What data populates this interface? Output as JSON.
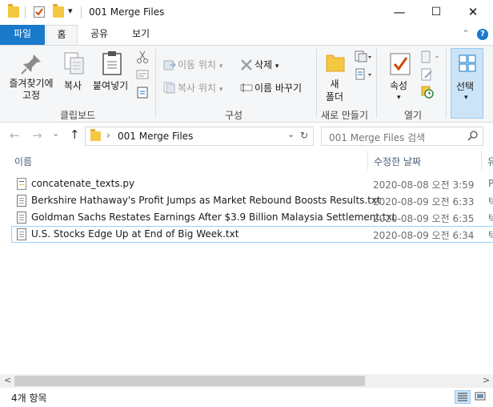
{
  "window": {
    "title": "001 Merge Files",
    "minimize": "—",
    "maximize": "☐",
    "close": "✕"
  },
  "qat": {
    "dropdown": "▾"
  },
  "ribbon_tabs": {
    "file": "파일",
    "home": "홈",
    "share": "공유",
    "view": "보기",
    "collapse": "⌃",
    "help": "?"
  },
  "clipboard": {
    "pin": "즐겨찾기에\n고정",
    "copy": "복사",
    "paste": "붙여넣기",
    "group": "클립보드"
  },
  "organize": {
    "move_to": "이동 위치",
    "copy_to": "복사 위치",
    "delete": "삭제",
    "rename": "이름 바꾸기",
    "group": "구성"
  },
  "new": {
    "new_folder": "새\n폴더",
    "group": "새로 만들기"
  },
  "open": {
    "properties": "속성",
    "group": "열기"
  },
  "select": {
    "select": "선택"
  },
  "address": {
    "back": "←",
    "forward": "→",
    "recent": "⌄",
    "up": "↑",
    "separator": "›",
    "path": "001 Merge Files",
    "dropdown": "⌄",
    "refresh": "↻",
    "search_placeholder": "001 Merge Files 검색",
    "search_icon": "⚲"
  },
  "columns": {
    "name": "이름",
    "modified": "수정한 날짜",
    "type": "유"
  },
  "files": [
    {
      "name": "concatenate_texts.py",
      "date": "2020-08-08 오전 3:59",
      "extra": "P",
      "icon": "python-file-icon"
    },
    {
      "name": "Berkshire Hathaway's Profit Jumps as Market Rebound Boosts Results.txt",
      "date": "2020-08-09 오전 6:33",
      "extra": "텍",
      "icon": "text-file-icon"
    },
    {
      "name": "Goldman Sachs Restates Earnings After $3.9 Billion Malaysia Settlement.txt",
      "date": "2020-08-09 오전 6:35",
      "extra": "텍",
      "icon": "text-file-icon"
    },
    {
      "name": "U.S. Stocks Edge Up at End of Big Week.txt",
      "date": "2020-08-09 오전 6:34",
      "extra": "텍",
      "icon": "text-file-icon"
    }
  ],
  "scroll": {
    "left": "<",
    "right": ">"
  },
  "status": {
    "count": "4개 항목"
  },
  "colors": {
    "accent": "#1979ca",
    "selection_border": "#99d1ff",
    "folder": "#f5c842"
  }
}
